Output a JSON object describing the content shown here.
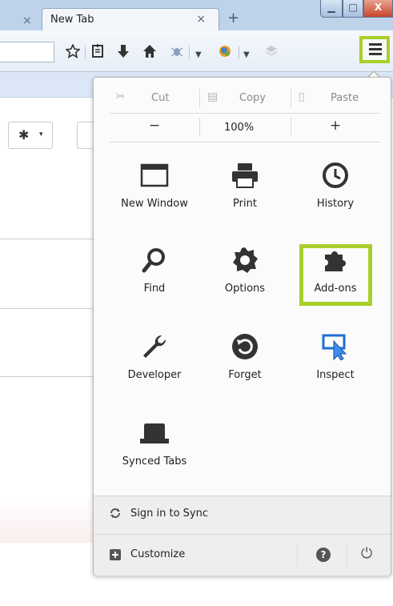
{
  "browser": {
    "prev_tab_fragment": "",
    "prev_tab_close": "×",
    "active_tab_title": "New Tab",
    "active_tab_close": "×",
    "new_tab": "+",
    "window_controls": {
      "minimize": "▁",
      "maximize": "□",
      "close": "X"
    }
  },
  "toolbar": {
    "icons": [
      "bookmark-star-icon",
      "reading-list-icon",
      "download-icon",
      "home-icon",
      "addon-bug-icon",
      "dropdown-icon",
      "addon-globe-icon",
      "dropdown-icon",
      "addon-gray-icon",
      "menu-icon"
    ]
  },
  "page": {
    "gear_caret": "▾"
  },
  "menu": {
    "edit": {
      "cut": "Cut",
      "copy": "Copy",
      "paste": "Paste"
    },
    "zoom": {
      "minus": "−",
      "value": "100%",
      "plus": "+"
    },
    "items": [
      {
        "label": "New Window",
        "icon": "new-window-icon"
      },
      {
        "label": "Print",
        "icon": "printer-icon"
      },
      {
        "label": "History",
        "icon": "history-clock-icon"
      },
      {
        "label": "Find",
        "icon": "magnifier-icon"
      },
      {
        "label": "Options",
        "icon": "gear-icon"
      },
      {
        "label": "Add-ons",
        "icon": "puzzle-piece-icon"
      },
      {
        "label": "Developer",
        "icon": "wrench-icon"
      },
      {
        "label": "Forget",
        "icon": "forget-arrow-icon"
      },
      {
        "label": "Inspect",
        "icon": "inspect-pointer-icon"
      },
      {
        "label": "Synced Tabs",
        "icon": "synced-tabs-icon"
      }
    ],
    "sign_in": "Sign in to Sync",
    "customize": "Customize",
    "help": "?",
    "quit": "⏻"
  },
  "colors": {
    "highlight": "#a8cf2a",
    "chrome": "#bed3ea",
    "panel": "#fbfbfb",
    "footer": "#eeeeee"
  }
}
